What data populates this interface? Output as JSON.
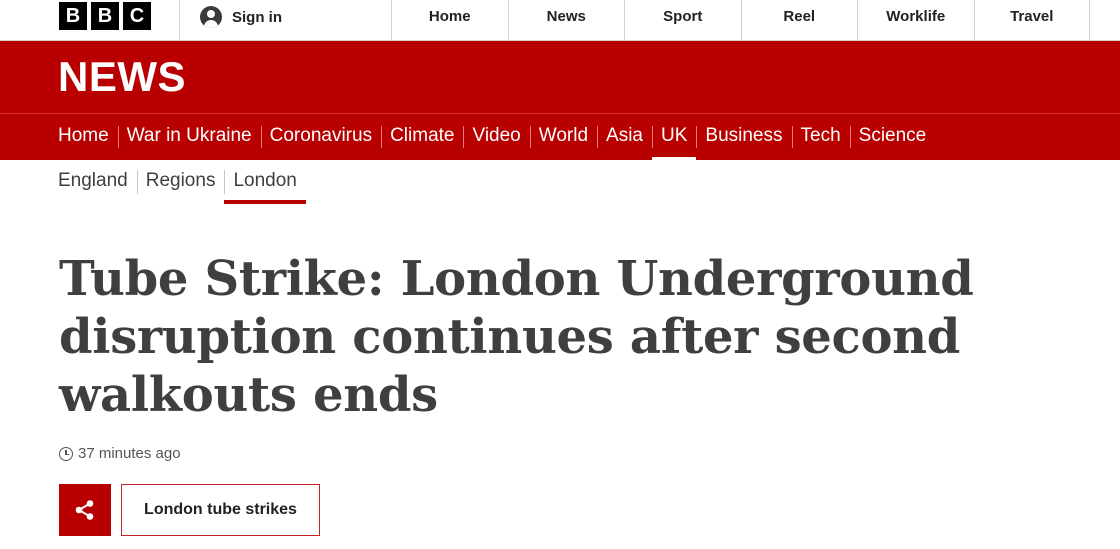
{
  "brand": {
    "logo_letters": [
      "B",
      "B",
      "C"
    ],
    "accent": "#b80000"
  },
  "account": {
    "signin_label": "Sign in",
    "icon": "user-icon"
  },
  "top_nav": [
    {
      "label": "Home"
    },
    {
      "label": "News"
    },
    {
      "label": "Sport"
    },
    {
      "label": "Reel"
    },
    {
      "label": "Worklife"
    },
    {
      "label": "Travel"
    }
  ],
  "news_header": {
    "title": "NEWS"
  },
  "section_nav": [
    {
      "label": "Home"
    },
    {
      "label": "War in Ukraine"
    },
    {
      "label": "Coronavirus"
    },
    {
      "label": "Climate"
    },
    {
      "label": "Video"
    },
    {
      "label": "World"
    },
    {
      "label": "Asia"
    },
    {
      "label": "UK",
      "active": true
    },
    {
      "label": "Business"
    },
    {
      "label": "Tech"
    },
    {
      "label": "Science"
    }
  ],
  "sub_nav": [
    {
      "label": "England"
    },
    {
      "label": "Regions"
    },
    {
      "label": "London",
      "active": true
    }
  ],
  "article": {
    "headline": "Tube Strike: London Underground disruption continues after second walkouts ends",
    "timestamp": "37 minutes ago",
    "topic_label": "London tube strikes",
    "share_icon": "share-icon",
    "clock_icon": "clock-icon"
  }
}
